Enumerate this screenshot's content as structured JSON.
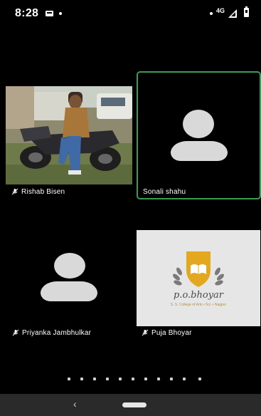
{
  "status_bar": {
    "time": "8:28",
    "network": "4G",
    "icons": [
      "notification-icon",
      "signal-icon",
      "battery-icon"
    ]
  },
  "participants": [
    {
      "name": "Rishab Bisen",
      "muted": true,
      "media": "video"
    },
    {
      "name": "Sonali shahu",
      "muted": false,
      "media": "avatar",
      "active_speaker": true
    },
    {
      "name": "Priyanka Jambhulkar",
      "muted": true,
      "media": "avatar"
    },
    {
      "name": "Puja Bhoyar",
      "muted": true,
      "media": "logo"
    }
  ],
  "logo": {
    "brand_text": "p.o.bhoyar",
    "tagline": "S. S. College of Arts • Sci. • Nagpur"
  },
  "pagination": {
    "dots": 10
  },
  "colors": {
    "active_border": "#3c9d52",
    "background": "#000000",
    "avatar": "#d9d9d9",
    "logo_gold": "#e3a820"
  },
  "nav_bar": {
    "icons": [
      "back-icon",
      "home-pill-icon"
    ]
  }
}
